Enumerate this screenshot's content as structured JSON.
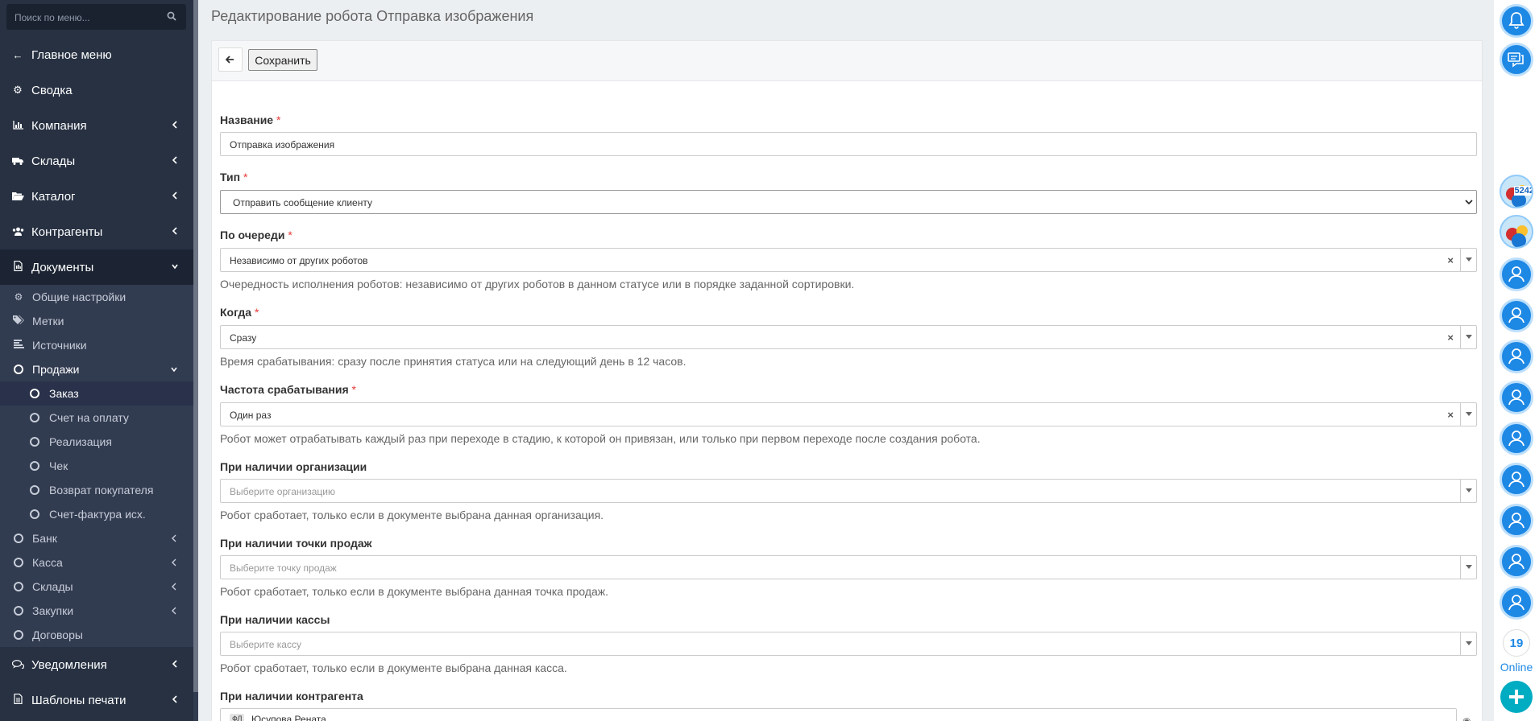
{
  "sidebar": {
    "search_placeholder": "Поиск по меню...",
    "items": [
      {
        "label": "Главное меню"
      },
      {
        "label": "Сводка"
      },
      {
        "label": "Компания"
      },
      {
        "label": "Склады"
      },
      {
        "label": "Каталог"
      },
      {
        "label": "Контрагенты"
      },
      {
        "label": "Документы"
      }
    ],
    "documents_sub": [
      {
        "label": "Общие настройки"
      },
      {
        "label": "Метки"
      },
      {
        "label": "Источники"
      },
      {
        "label": "Продажи"
      }
    ],
    "sales_sub": [
      {
        "label": "Заказ"
      },
      {
        "label": "Счет на оплату"
      },
      {
        "label": "Реализация"
      },
      {
        "label": "Чек"
      },
      {
        "label": "Возврат покупателя"
      },
      {
        "label": "Счет-фактура исх."
      }
    ],
    "documents_sub2": [
      {
        "label": "Банк"
      },
      {
        "label": "Касса"
      },
      {
        "label": "Склады"
      },
      {
        "label": "Закупки"
      },
      {
        "label": "Договоры"
      }
    ],
    "bottom_items": [
      {
        "label": "Уведомления"
      },
      {
        "label": "Шаблоны печати"
      }
    ]
  },
  "page": {
    "title": "Редактирование робота Отправка изображения"
  },
  "toolbar": {
    "save_label": "Сохранить"
  },
  "form": {
    "name": {
      "label": "Название",
      "required": "*",
      "value": "Отправка изображения"
    },
    "type": {
      "label": "Тип",
      "required": "*",
      "value": "Отправить сообщение клиенту"
    },
    "queue": {
      "label": "По очереди",
      "required": "*",
      "value": "Независимо от других роботов",
      "help": "Очередность исполнения роботов: независимо от других роботов в данном статусе или в порядке заданной сортировки."
    },
    "when": {
      "label": "Когда",
      "required": "*",
      "value": "Сразу",
      "help": "Время срабатывания: сразу после принятия статуса или на следующий день в 12 часов."
    },
    "frequency": {
      "label": "Частота срабатывания",
      "required": "*",
      "value": "Один раз",
      "help": "Робот может отрабатывать каждый раз при переходе в стадию, к которой он привязан, или только при первом переходе после создания робота."
    },
    "organization": {
      "label": "При наличии организации",
      "placeholder": "Выберите организацию",
      "help": "Робот сработает, только если в документе выбрана данная организация."
    },
    "point_of_sale": {
      "label": "При наличии точки продаж",
      "placeholder": "Выберите точку продаж",
      "help": "Робот сработает, только если в документе выбрана данная точка продаж."
    },
    "cashbox": {
      "label": "При наличии кассы",
      "placeholder": "Выберите кассу",
      "help": "Робот сработает, только если в документе выбрана данная касса."
    },
    "contractor": {
      "label": "При наличии контрагента",
      "tag_prefix": "ФЛ",
      "value": "Юсупова Рената"
    }
  },
  "right_bar": {
    "badge_count": "5242",
    "online_count": "19",
    "online_label": "Online"
  },
  "colors": {
    "sidebar_bg": "#273142",
    "accent": "#1e88e5",
    "add_button": "#00acc1",
    "required": "#e53935"
  }
}
